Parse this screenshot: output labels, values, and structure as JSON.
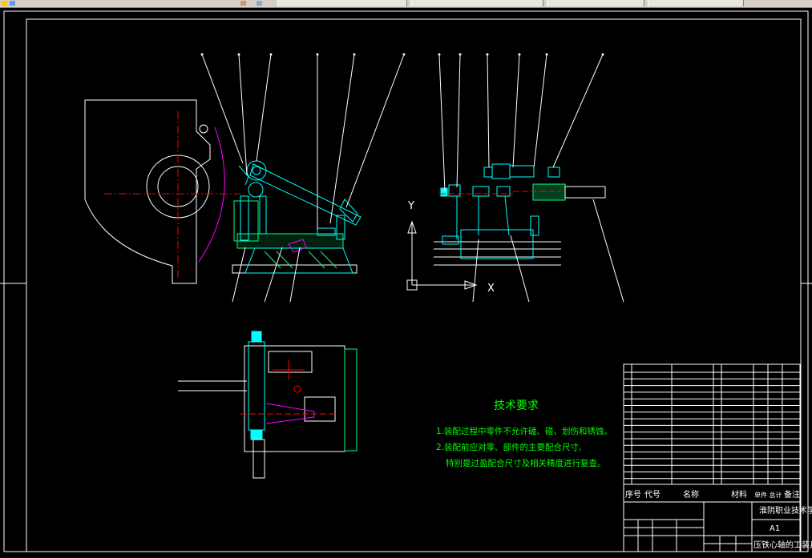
{
  "tech_req": {
    "title": "技术要求",
    "line1": "1.装配过程中零件不允许磕、碰、划伤和锈蚀。",
    "line2": "2.装配前应对零、部件的主要配合尺寸,",
    "line3": "特别是过盈配合尺寸及相关精度进行复查。"
  },
  "axes": {
    "y": "Y",
    "x": "X"
  },
  "title_block": {
    "h_index": "序号",
    "h_code": "代号",
    "h_name": "名称",
    "h_material": "材料",
    "h_weight": "单件 总计",
    "h_remark": "备注",
    "school": "淮阴职业技术学院",
    "sheet": "A1",
    "drawing_name": "压铁心轴的工装具"
  },
  "colors": {
    "background": "#000000",
    "frame": "#ffffff",
    "part": "#00ffff",
    "hatch": "#00ff7f",
    "centerline": "#ff0000",
    "highlight": "#ff00ff",
    "text": "#00ff00",
    "tabbar": "#d4d0c8"
  }
}
